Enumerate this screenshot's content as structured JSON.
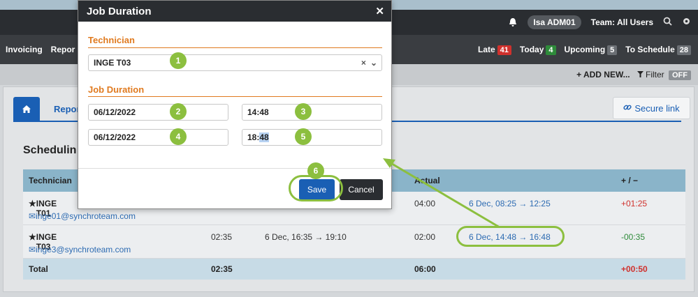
{
  "header": {
    "user": "Isa ADM01",
    "team": "Team: All Users"
  },
  "nav": {
    "left_items": [
      "Invoicing",
      "Repor"
    ],
    "counters": [
      {
        "label": "Late",
        "count": "41",
        "color": "#d0312d"
      },
      {
        "label": "Today",
        "count": "4",
        "color": "#2e8b3a"
      },
      {
        "label": "Upcoming",
        "count": "5",
        "color": "#6b6f74"
      },
      {
        "label": "To Schedule",
        "count": "28",
        "color": "#6b6f74"
      }
    ]
  },
  "toolbar": {
    "add_new": "+ ADD NEW...",
    "filter": "Filter",
    "filter_state": "OFF"
  },
  "tabs": {
    "reports": "Repor",
    "secure_link": "Secure link"
  },
  "section": {
    "title": "Schedulin"
  },
  "table": {
    "headers": [
      "Technician",
      "Actual",
      "+ / −"
    ],
    "rows": [
      {
        "name": "INGE T01",
        "email": "inge01@synchroteam.com",
        "planned_duration": "",
        "planned_range": "",
        "actual_duration": "04:00",
        "actual_range": "6 Dec, 08:25 → 12:25",
        "diff": "+01:25"
      },
      {
        "name": "INGE T03",
        "email": "inge3@synchroteam.com",
        "planned_duration": "02:35",
        "planned_range": "6 Dec, 16:35 → 19:10",
        "actual_duration": "02:00",
        "actual_range": "6 Dec, 14:48 → 16:48",
        "diff": "-00:35"
      }
    ],
    "total": {
      "label": "Total",
      "planned": "02:35",
      "actual": "06:00",
      "diff": "+00:50"
    }
  },
  "modal": {
    "title": "Job Duration",
    "technician_label": "Technician",
    "technician_value": "INGE T03",
    "duration_label": "Job Duration",
    "start_date": "06/12/2022",
    "start_time": "14:48",
    "end_date": "06/12/2022",
    "end_time_prefix": "18:",
    "end_time_selected": "48",
    "save": "Save",
    "cancel": "Cancel"
  },
  "callouts": [
    "1",
    "2",
    "3",
    "4",
    "5",
    "6"
  ],
  "colors": {
    "accent": "#1a5fb4",
    "callout": "#8cbf3f",
    "section_label": "#e07a1f"
  }
}
